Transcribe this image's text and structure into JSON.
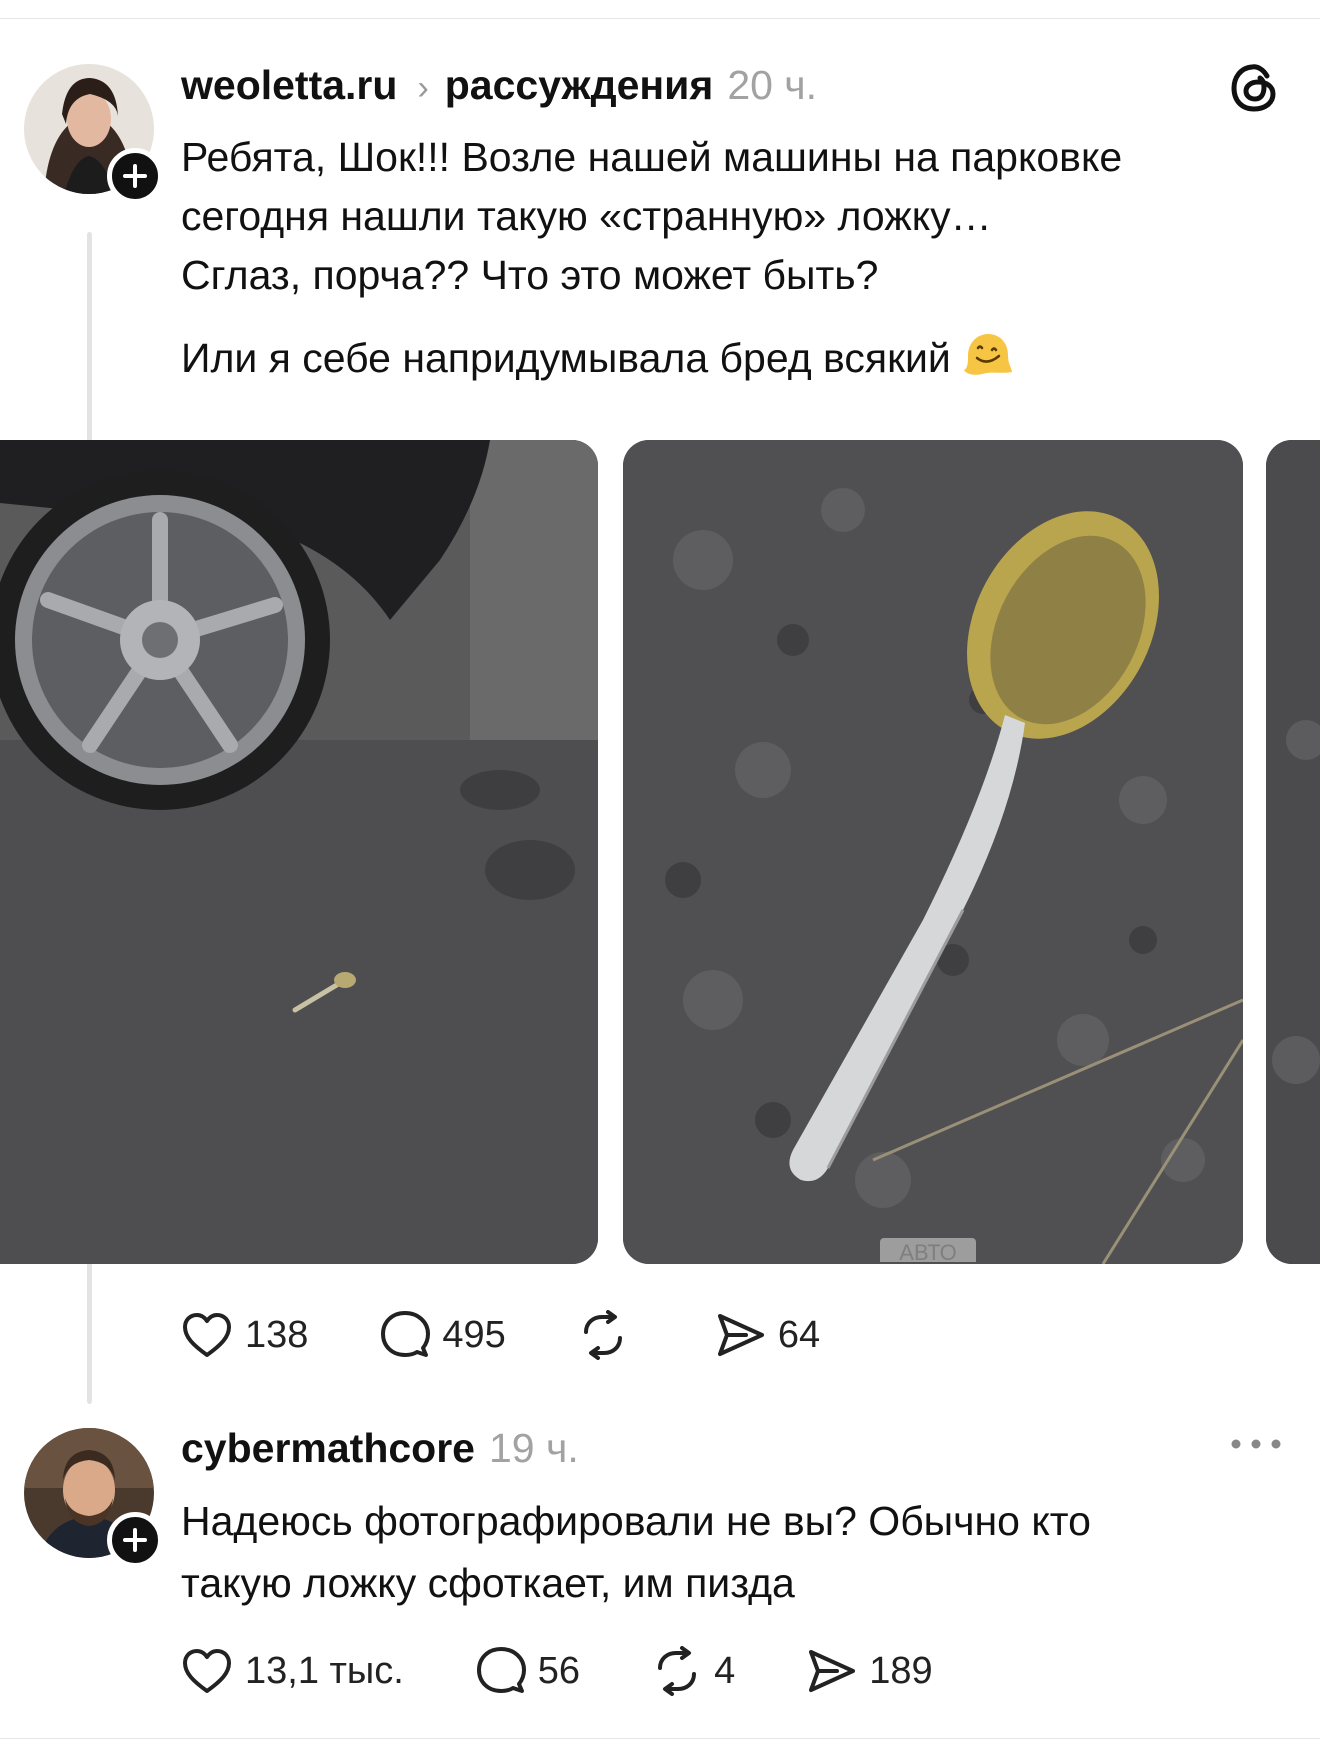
{
  "post": {
    "author": "weoletta.ru",
    "context": "рассуждения",
    "time": "20 ч.",
    "text_lines": [
      "Ребята, Шок!!! Возле нашей машины на парковке",
      "сегодня нашли такую «странную» ложку…",
      "Сглаз, порча?? Что это может быть?",
      "Или я себе напридумывала бред всякий"
    ],
    "emoji": "melting-face-emoji",
    "photo_badge": "АВТО",
    "likes": "138",
    "comments": "495",
    "shares": "64"
  },
  "reply": {
    "author": "cybermathcore",
    "time": "19 ч.",
    "text_lines": [
      "Надеюсь фотографировали не вы? Обычно кто",
      "такую ложку сфоткает, им пизда"
    ],
    "likes": "13,1 тыс.",
    "comments": "56",
    "reposts": "4",
    "shares": "189"
  },
  "icons": {
    "logo": "threads-logo-icon",
    "like": "heart-icon",
    "comment": "comment-bubble-icon",
    "repost": "repost-icon",
    "share": "send-icon",
    "more": "more-dots-icon",
    "follow": "plus-icon"
  }
}
